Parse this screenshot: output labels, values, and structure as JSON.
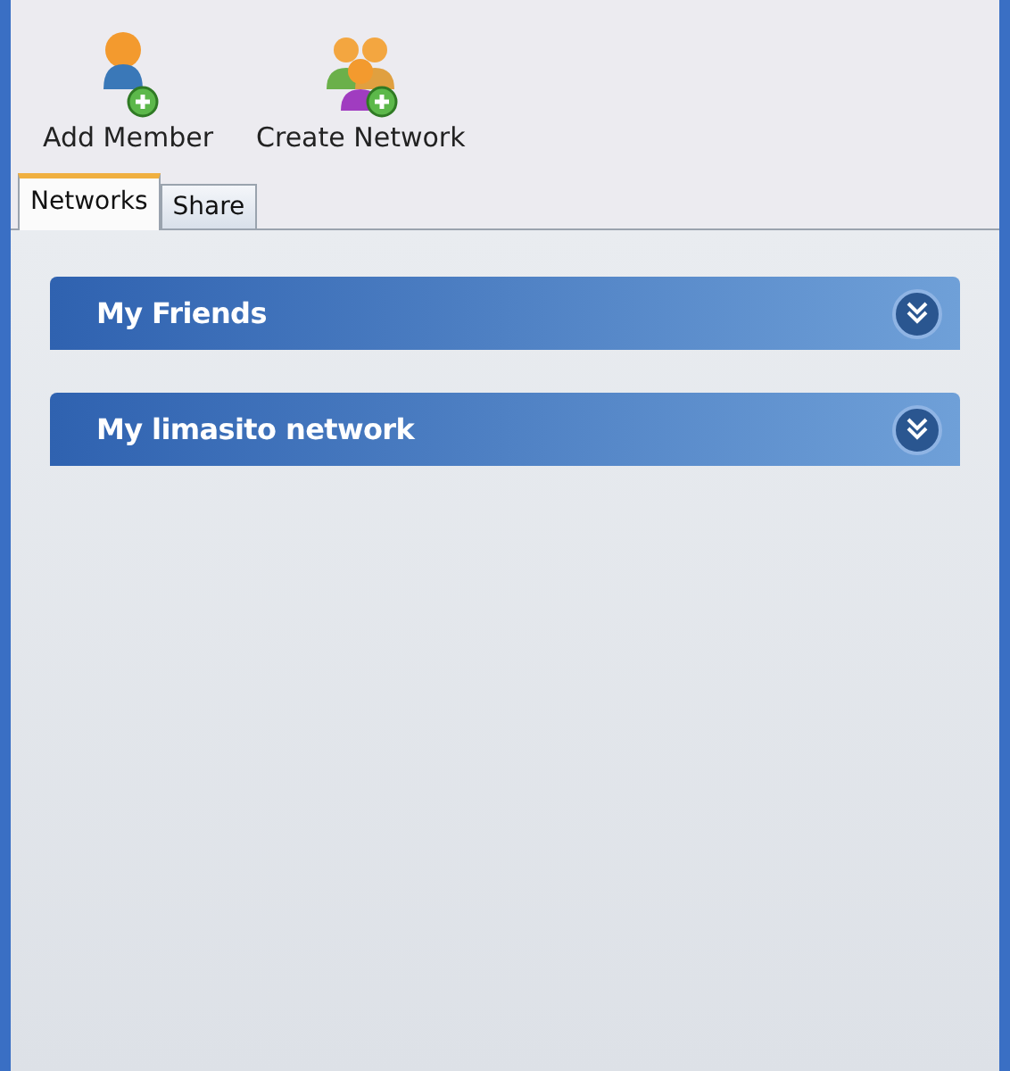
{
  "toolbar": [
    {
      "label": "Add Member",
      "kind": "person"
    },
    {
      "label": "Create Network",
      "kind": "group"
    }
  ],
  "tabs": [
    {
      "label": "Networks",
      "selected": true
    },
    {
      "label": "Share",
      "selected": false
    }
  ],
  "groups": [
    {
      "title": "My Friends",
      "expanded": false
    },
    {
      "title": "My limasito network",
      "expanded": false
    }
  ]
}
